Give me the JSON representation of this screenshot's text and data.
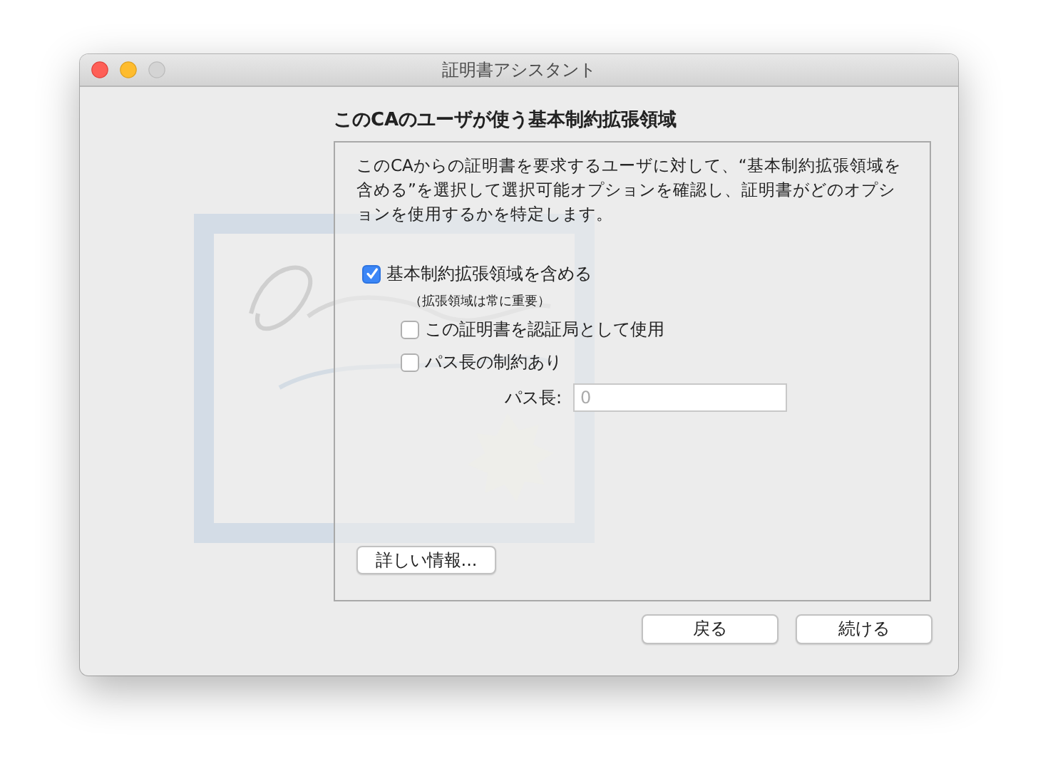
{
  "window": {
    "title": "証明書アシスタント"
  },
  "heading": "このCAのユーザが使う基本制約拡張領域",
  "description": "このCAからの証明書を要求するユーザに対して、“基本制約拡張領域を含める”を選択して選択可能オプションを確認し、証明書がどのオプションを使用するかを特定します。",
  "options": [
    {
      "kind": "checkbox",
      "label": "基本制約拡張領域を含める",
      "checked": true,
      "children": [
        {
          "kind": "note",
          "label": "（拡張領域は常に重要）"
        },
        {
          "kind": "checkbox",
          "label": "この証明書を認証局として使用",
          "checked": false
        },
        {
          "kind": "checkbox",
          "label": "パス長の制約あり",
          "checked": false
        }
      ]
    }
  ],
  "path_length": {
    "label": "パス長:",
    "placeholder": "0"
  },
  "details_button": "詳しい情報...",
  "buttons": [
    "戻る",
    "続ける"
  ]
}
